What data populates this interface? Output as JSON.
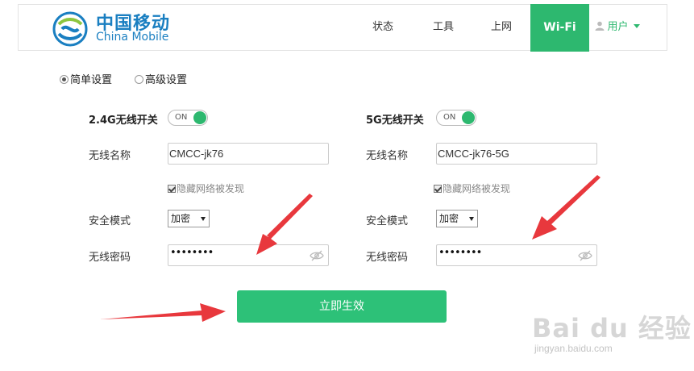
{
  "brand": {
    "name_cn": "中国移动",
    "name_en": "China Mobile",
    "color": "#1a7fc1"
  },
  "nav": {
    "status": "状态",
    "tools": "工具",
    "internet": "上网",
    "wifi": "Wi-Fi",
    "user": "用户",
    "active": "Wi-Fi",
    "accent": "#2db86f"
  },
  "mode": {
    "simple": "简单设置",
    "advanced": "高级设置",
    "selected": "简单设置"
  },
  "band24": {
    "switch_label": "2.4G无线开关",
    "switch_state": "ON",
    "ssid_label": "无线名称",
    "ssid_value": "CMCC-jk76",
    "hide_label": "隐藏网络被发现",
    "hide_checked": true,
    "security_label": "安全模式",
    "security_value": "加密",
    "password_label": "无线密码",
    "password_mask": "••••••••"
  },
  "band5": {
    "switch_label": "5G无线开关",
    "switch_state": "ON",
    "ssid_label": "无线名称",
    "ssid_value": "CMCC-jk76-5G",
    "hide_label": "隐藏网络被发现",
    "hide_checked": true,
    "security_label": "安全模式",
    "security_value": "加密",
    "password_label": "无线密码",
    "password_mask": "••••••••"
  },
  "apply_label": "立即生效",
  "apply_color": "#2dc178",
  "watermark": {
    "text": "Bai du 经验",
    "url": "jingyan.baidu.com"
  },
  "icons": [
    "china-mobile-logo-icon",
    "user-icon",
    "chevron-down-icon",
    "eye-slash-icon",
    "red-arrow-icon"
  ]
}
